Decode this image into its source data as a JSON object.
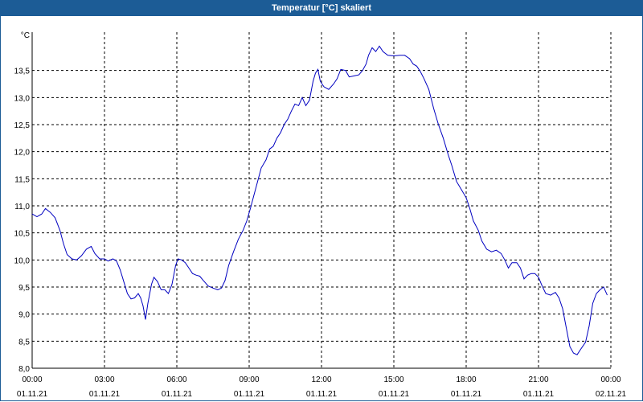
{
  "title": "Temperatur [°C] skaliert",
  "colors": {
    "titlebar": "#1c5c96",
    "line": "#0000c0",
    "grid": "#000000"
  },
  "chart_data": {
    "type": "line",
    "title": "Temperatur [°C] skaliert",
    "ylabel": "°C",
    "xlabel": "",
    "ylim": [
      8.0,
      14.0
    ],
    "xlim": [
      0,
      24
    ],
    "grid": true,
    "y_ticks": [
      "8,0",
      "8,5",
      "9,0",
      "9,5",
      "10,0",
      "10,5",
      "11,0",
      "11,5",
      "12,0",
      "12,5",
      "13,0",
      "13,5"
    ],
    "x_ticks": [
      {
        "x": 0,
        "time": "00:00",
        "date": "01.11.21"
      },
      {
        "x": 3,
        "time": "03:00",
        "date": "01.11.21"
      },
      {
        "x": 6,
        "time": "06:00",
        "date": "01.11.21"
      },
      {
        "x": 9,
        "time": "09:00",
        "date": "01.11.21"
      },
      {
        "x": 12,
        "time": "12:00",
        "date": "01.11.21"
      },
      {
        "x": 15,
        "time": "15:00",
        "date": "01.11.21"
      },
      {
        "x": 18,
        "time": "18:00",
        "date": "01.11.21"
      },
      {
        "x": 21,
        "time": "21:00",
        "date": "01.11.21"
      },
      {
        "x": 24,
        "time": "00:00",
        "date": "02.11.21"
      }
    ],
    "x_unit": "hours",
    "series": [
      {
        "points": [
          [
            0.0,
            10.85
          ],
          [
            0.2,
            10.8
          ],
          [
            0.4,
            10.85
          ],
          [
            0.55,
            10.95
          ],
          [
            0.75,
            10.88
          ],
          [
            0.95,
            10.78
          ],
          [
            1.15,
            10.55
          ],
          [
            1.3,
            10.3
          ],
          [
            1.45,
            10.1
          ],
          [
            1.65,
            10.02
          ],
          [
            1.85,
            10.0
          ],
          [
            2.05,
            10.08
          ],
          [
            2.25,
            10.2
          ],
          [
            2.45,
            10.25
          ],
          [
            2.6,
            10.12
          ],
          [
            2.8,
            10.02
          ],
          [
            3.0,
            10.02
          ],
          [
            3.15,
            9.98
          ],
          [
            3.35,
            10.02
          ],
          [
            3.5,
            9.98
          ],
          [
            3.65,
            9.82
          ],
          [
            3.8,
            9.6
          ],
          [
            3.95,
            9.38
          ],
          [
            4.1,
            9.28
          ],
          [
            4.25,
            9.3
          ],
          [
            4.4,
            9.38
          ],
          [
            4.5,
            9.3
          ],
          [
            4.6,
            9.15
          ],
          [
            4.7,
            8.9
          ],
          [
            4.8,
            9.2
          ],
          [
            4.95,
            9.55
          ],
          [
            5.05,
            9.68
          ],
          [
            5.2,
            9.6
          ],
          [
            5.35,
            9.45
          ],
          [
            5.5,
            9.45
          ],
          [
            5.65,
            9.38
          ],
          [
            5.8,
            9.55
          ],
          [
            5.95,
            9.9
          ],
          [
            6.05,
            10.02
          ],
          [
            6.2,
            10.0
          ],
          [
            6.35,
            9.95
          ],
          [
            6.5,
            9.85
          ],
          [
            6.65,
            9.75
          ],
          [
            6.8,
            9.72
          ],
          [
            6.95,
            9.7
          ],
          [
            7.1,
            9.62
          ],
          [
            7.3,
            9.52
          ],
          [
            7.5,
            9.48
          ],
          [
            7.7,
            9.45
          ],
          [
            7.85,
            9.48
          ],
          [
            8.0,
            9.62
          ],
          [
            8.15,
            9.9
          ],
          [
            8.35,
            10.15
          ],
          [
            8.55,
            10.38
          ],
          [
            8.75,
            10.55
          ],
          [
            8.9,
            10.72
          ],
          [
            9.05,
            10.95
          ],
          [
            9.2,
            11.2
          ],
          [
            9.35,
            11.45
          ],
          [
            9.5,
            11.7
          ],
          [
            9.7,
            11.85
          ],
          [
            9.85,
            12.05
          ],
          [
            10.0,
            12.1
          ],
          [
            10.15,
            12.25
          ],
          [
            10.3,
            12.35
          ],
          [
            10.45,
            12.5
          ],
          [
            10.6,
            12.6
          ],
          [
            10.75,
            12.75
          ],
          [
            10.9,
            12.88
          ],
          [
            11.05,
            12.85
          ],
          [
            11.2,
            13.0
          ],
          [
            11.35,
            12.85
          ],
          [
            11.5,
            12.95
          ],
          [
            11.65,
            13.3
          ],
          [
            11.75,
            13.45
          ],
          [
            11.85,
            13.52
          ],
          [
            11.95,
            13.3
          ],
          [
            12.1,
            13.2
          ],
          [
            12.3,
            13.15
          ],
          [
            12.5,
            13.25
          ],
          [
            12.65,
            13.35
          ],
          [
            12.8,
            13.52
          ],
          [
            13.0,
            13.5
          ],
          [
            13.15,
            13.38
          ],
          [
            13.35,
            13.4
          ],
          [
            13.55,
            13.42
          ],
          [
            13.7,
            13.5
          ],
          [
            13.85,
            13.62
          ],
          [
            13.95,
            13.78
          ],
          [
            14.1,
            13.92
          ],
          [
            14.25,
            13.85
          ],
          [
            14.4,
            13.95
          ],
          [
            14.55,
            13.85
          ],
          [
            14.75,
            13.78
          ],
          [
            15.0,
            13.77
          ],
          [
            15.25,
            13.78
          ],
          [
            15.45,
            13.78
          ],
          [
            15.65,
            13.72
          ],
          [
            15.8,
            13.62
          ],
          [
            15.95,
            13.58
          ],
          [
            16.1,
            13.48
          ],
          [
            16.25,
            13.35
          ],
          [
            16.45,
            13.15
          ],
          [
            16.65,
            12.8
          ],
          [
            16.85,
            12.5
          ],
          [
            17.05,
            12.25
          ],
          [
            17.25,
            11.95
          ],
          [
            17.4,
            11.75
          ],
          [
            17.6,
            11.45
          ],
          [
            17.8,
            11.3
          ],
          [
            18.0,
            11.15
          ],
          [
            18.15,
            10.95
          ],
          [
            18.3,
            10.72
          ],
          [
            18.5,
            10.55
          ],
          [
            18.65,
            10.35
          ],
          [
            18.85,
            10.2
          ],
          [
            19.05,
            10.15
          ],
          [
            19.25,
            10.18
          ],
          [
            19.45,
            10.12
          ],
          [
            19.6,
            10.0
          ],
          [
            19.75,
            9.85
          ],
          [
            19.9,
            9.95
          ],
          [
            20.1,
            9.95
          ],
          [
            20.25,
            9.85
          ],
          [
            20.4,
            9.65
          ],
          [
            20.55,
            9.72
          ],
          [
            20.7,
            9.75
          ],
          [
            20.85,
            9.75
          ],
          [
            21.0,
            9.68
          ],
          [
            21.15,
            9.52
          ],
          [
            21.3,
            9.38
          ],
          [
            21.5,
            9.35
          ],
          [
            21.7,
            9.4
          ],
          [
            21.85,
            9.3
          ],
          [
            22.0,
            9.1
          ],
          [
            22.15,
            8.75
          ],
          [
            22.3,
            8.4
          ],
          [
            22.45,
            8.28
          ],
          [
            22.6,
            8.25
          ],
          [
            22.75,
            8.35
          ],
          [
            22.95,
            8.48
          ],
          [
            23.1,
            8.78
          ],
          [
            23.25,
            9.2
          ],
          [
            23.4,
            9.38
          ],
          [
            23.55,
            9.45
          ],
          [
            23.7,
            9.5
          ],
          [
            23.85,
            9.35
          ]
        ]
      }
    ]
  }
}
